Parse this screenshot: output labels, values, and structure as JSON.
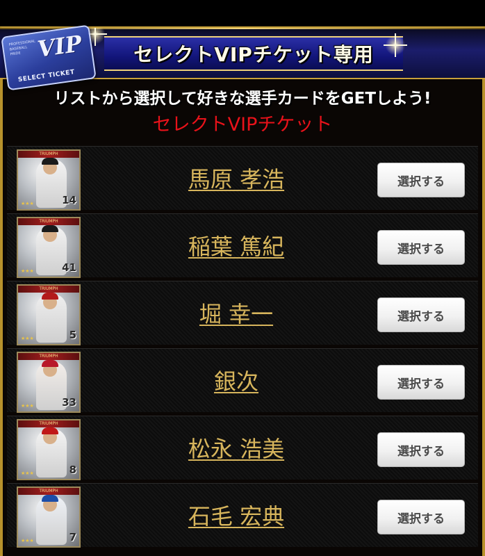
{
  "header": {
    "title": "セレクトVIPチケット専用",
    "subtitle": "リストから選択して好きな選手カードをGETしよう!",
    "ticket_type": "セレクトVIPチケット"
  },
  "ticket_badge": {
    "vip": "VIP",
    "tiny_text": "PROFESSIONAL BASEBALL PRIDE",
    "select_ticket": "SELECT TICKET"
  },
  "card_ribbon": "TRIUMPH",
  "players": [
    {
      "name": "馬原 孝浩",
      "number": "14",
      "button": "選択する",
      "uniform_color": "#f4f4f4",
      "cap_color": "#1a1a1a"
    },
    {
      "name": "稲葉 篤紀",
      "number": "41",
      "button": "選択する",
      "uniform_color": "#f2f2f2",
      "cap_color": "#1a1a1a"
    },
    {
      "name": "堀 幸一",
      "number": "5",
      "button": "選択する",
      "uniform_color": "#efefef",
      "cap_color": "#b31a1a"
    },
    {
      "name": "銀次",
      "number": "33",
      "button": "選択する",
      "uniform_color": "#f3eeea",
      "cap_color": "#b8182a"
    },
    {
      "name": "松永 浩美",
      "number": "8",
      "button": "選択する",
      "uniform_color": "#f4f4f4",
      "cap_color": "#c01818"
    },
    {
      "name": "石毛 宏典",
      "number": "7",
      "button": "選択する",
      "uniform_color": "#eef1f6",
      "cap_color": "#1d4ea8"
    }
  ],
  "colors": {
    "gold_border": "#c9a23a",
    "name_gold": "#d7b55c",
    "banner_blue": "#12157a",
    "red_text": "#e8121a"
  }
}
